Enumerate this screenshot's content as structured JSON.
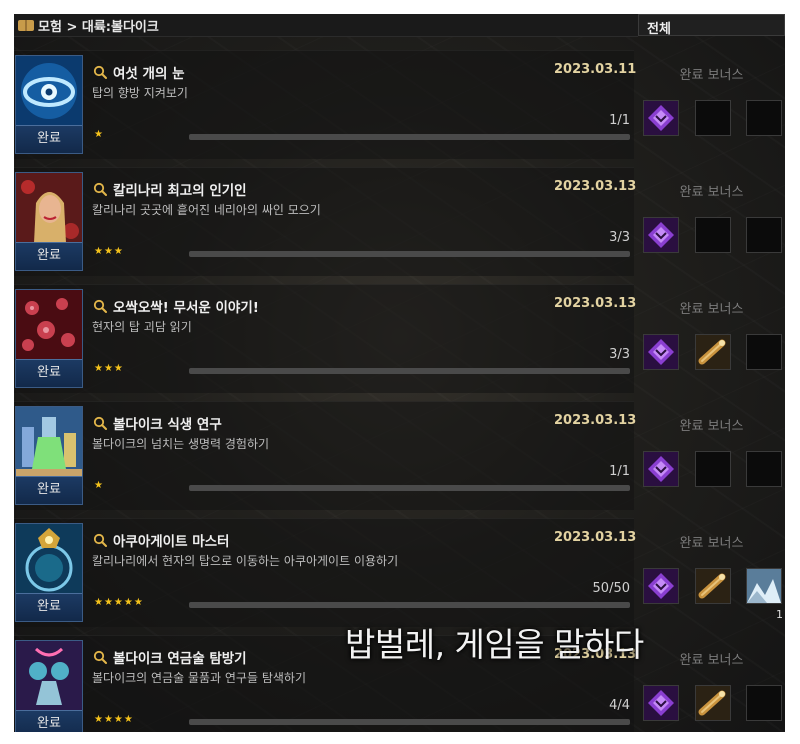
{
  "header": {
    "breadcrumb": "모험 > 대륙:볼다이크",
    "filter_value": "전체",
    "book_icon": "book-icon"
  },
  "bonus_label": "완료 보너스",
  "status_label": "완료",
  "achievements": [
    {
      "title": "여섯 개의 눈",
      "description": "탑의 향방 지켜보기",
      "date": "2023.03.11",
      "progress_text": "1/1",
      "progress": 1.0,
      "stars": "★",
      "thumbnail": "eye-artwork",
      "rewards": [
        "purple-emblem-icon",
        "empty",
        "empty"
      ],
      "reward_qty": [
        "",
        "",
        ""
      ]
    },
    {
      "title": "칼리나리 최고의 인기인",
      "description": "칼리나리 곳곳에 흩어진 네리아의 싸인 모으기",
      "date": "2023.03.13",
      "progress_text": "3/3",
      "progress": 1.0,
      "stars": "★★★",
      "thumbnail": "woman-portrait-artwork",
      "rewards": [
        "purple-emblem-icon",
        "empty",
        "empty"
      ],
      "reward_qty": [
        "",
        "",
        ""
      ]
    },
    {
      "title": "오싹오싹! 무서운 이야기!",
      "description": "현자의 탑 괴담 읽기",
      "date": "2023.03.13",
      "progress_text": "3/3",
      "progress": 1.0,
      "stars": "★★★",
      "thumbnail": "red-hands-artwork",
      "rewards": [
        "purple-emblem-icon",
        "telescope-icon",
        "empty"
      ],
      "reward_qty": [
        "",
        "",
        ""
      ]
    },
    {
      "title": "볼다이크 식생 연구",
      "description": "볼다이크의 넘치는 생명력 경험하기",
      "date": "2023.03.13",
      "progress_text": "1/1",
      "progress": 1.0,
      "stars": "★",
      "thumbnail": "potion-artwork",
      "rewards": [
        "purple-emblem-icon",
        "empty",
        "empty"
      ],
      "reward_qty": [
        "",
        "",
        ""
      ]
    },
    {
      "title": "아쿠아게이트 마스터",
      "description": "칼리나리에서 현자의 탑으로 이동하는 아쿠아게이트 이용하기",
      "date": "2023.03.13",
      "progress_text": "50/50",
      "progress": 1.0,
      "stars": "★★★★★",
      "thumbnail": "gate-artwork",
      "rewards": [
        "purple-emblem-icon",
        "telescope-icon",
        "ice-landscape-icon"
      ],
      "reward_qty": [
        "",
        "",
        "1"
      ]
    },
    {
      "title": "볼다이크 연금술 탐방기",
      "description": "볼다이크의 연금술 물품과 연구들 탐색하기",
      "date": "2023.03.13",
      "progress_text": "4/4",
      "progress": 1.0,
      "stars": "★★★★",
      "thumbnail": "alchemy-artwork",
      "rewards": [
        "purple-emblem-icon",
        "telescope-icon",
        "empty"
      ],
      "reward_qty": [
        "",
        "",
        ""
      ]
    }
  ],
  "watermark": "밥벌레, 게임을 말하다",
  "colors": {
    "date": "#e3d3a2",
    "star": "#f4c21b",
    "status_bg": "#1c3a63",
    "emblem": "#8a3fd1"
  }
}
